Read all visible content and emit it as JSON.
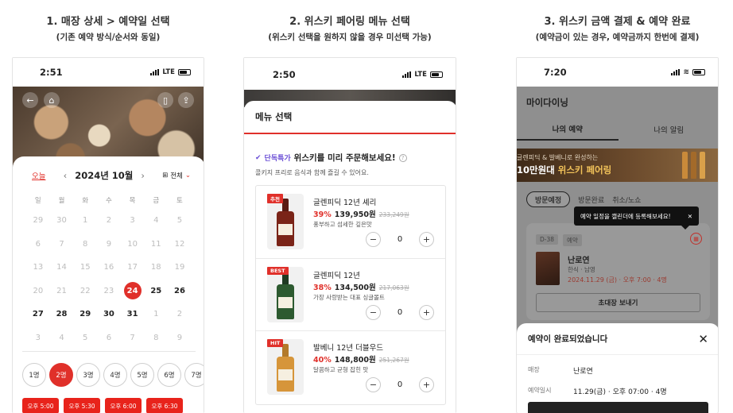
{
  "steps": [
    {
      "title": "1. 매장 상세 > 예약일 선택",
      "subtitle": "(기존 예약 방식/순서와 동일)"
    },
    {
      "title": "2. 위스키 페어링 메뉴 선택",
      "subtitle": "(위스키 선택을 원하지 않을 경우 미선택 가능)"
    },
    {
      "title": "3. 위스키 금액 결제 & 예약 완료",
      "subtitle": "(예약금이 있는 경우, 예약금까지 한번에 결제)"
    }
  ],
  "phone1": {
    "time": "2:51",
    "network": "LTE",
    "today": "오늘",
    "month": "2024년 10월",
    "prev": "‹",
    "next": "›",
    "filter": "전체",
    "weekdays": [
      "일",
      "월",
      "화",
      "수",
      "목",
      "금",
      "토"
    ],
    "days": [
      [
        "29",
        "30",
        "1",
        "2",
        "3",
        "4",
        "5"
      ],
      [
        "6",
        "7",
        "8",
        "9",
        "10",
        "11",
        "12"
      ],
      [
        "13",
        "14",
        "15",
        "16",
        "17",
        "18",
        "19"
      ],
      [
        "20",
        "21",
        "22",
        "23",
        "24",
        "25",
        "26"
      ],
      [
        "27",
        "28",
        "29",
        "30",
        "31",
        "1",
        "2"
      ],
      [
        "3",
        "4",
        "5",
        "6",
        "7",
        "8",
        "9"
      ]
    ],
    "people": [
      "1명",
      "2명",
      "3명",
      "4명",
      "5명",
      "6명",
      "7명"
    ],
    "times": [
      "오후 5:00",
      "오후 5:30",
      "오후 6:00",
      "오후 6:30"
    ]
  },
  "phone2": {
    "time": "2:50",
    "network": "LTE",
    "header": "메뉴 선택",
    "promo_badge": "단독특가",
    "promo_title": "위스키를 미리 주문해보세요!",
    "promo_sub": "콜키지 프리로 음식과 함께 즐길 수 있어요.",
    "items": [
      {
        "tag": "추천",
        "name": "글렌피딕 12년 셰리",
        "pct": "39%",
        "price": "139,950원",
        "orig": "233,249원",
        "desc": "풍부하고 섬세한 깊은맛",
        "qty": "0"
      },
      {
        "tag": "BEST",
        "name": "글렌피딕 12년",
        "pct": "38%",
        "price": "134,500원",
        "orig": "217,063원",
        "desc": "가장 사랑받는 대표 싱글몰트",
        "qty": "0"
      },
      {
        "tag": "HIT",
        "name": "발베니 12년 더블우드",
        "pct": "40%",
        "price": "148,800원",
        "orig": "251,267원",
        "desc": "달콤하고 균형 잡힌 맛",
        "qty": "0"
      }
    ],
    "minus": "−",
    "plus": "+"
  },
  "phone3": {
    "time": "7:20",
    "page_title": "마이다이닝",
    "tabs": [
      "나의 예약",
      "나의 알림"
    ],
    "banner_line1": "글렌피딕 & 발베니로 완성하는",
    "banner_line2a": "10만원대",
    "banner_line2b": "위스키 페어링",
    "filters": [
      "방문예정",
      "방문완료",
      "취소/노쇼"
    ],
    "tooltip": "예약 일정을 캘린더에 등록해보세요!",
    "tooltip_close": "✕",
    "dday": "D-38",
    "chip2": "예약",
    "restaurant": "난로연",
    "category": "한식 · 남영",
    "datetime": "2024.11.29 (금) · 오후 7:00 · 4명",
    "invite": "초대장 보내기",
    "sheet_title": "예약이 완료되었습니다",
    "close": "✕",
    "rows": [
      {
        "k": "매장",
        "v": "난로연"
      },
      {
        "k": "예약일시",
        "v": "11.29(금) · 오후 07:00 · 4명"
      }
    ]
  }
}
